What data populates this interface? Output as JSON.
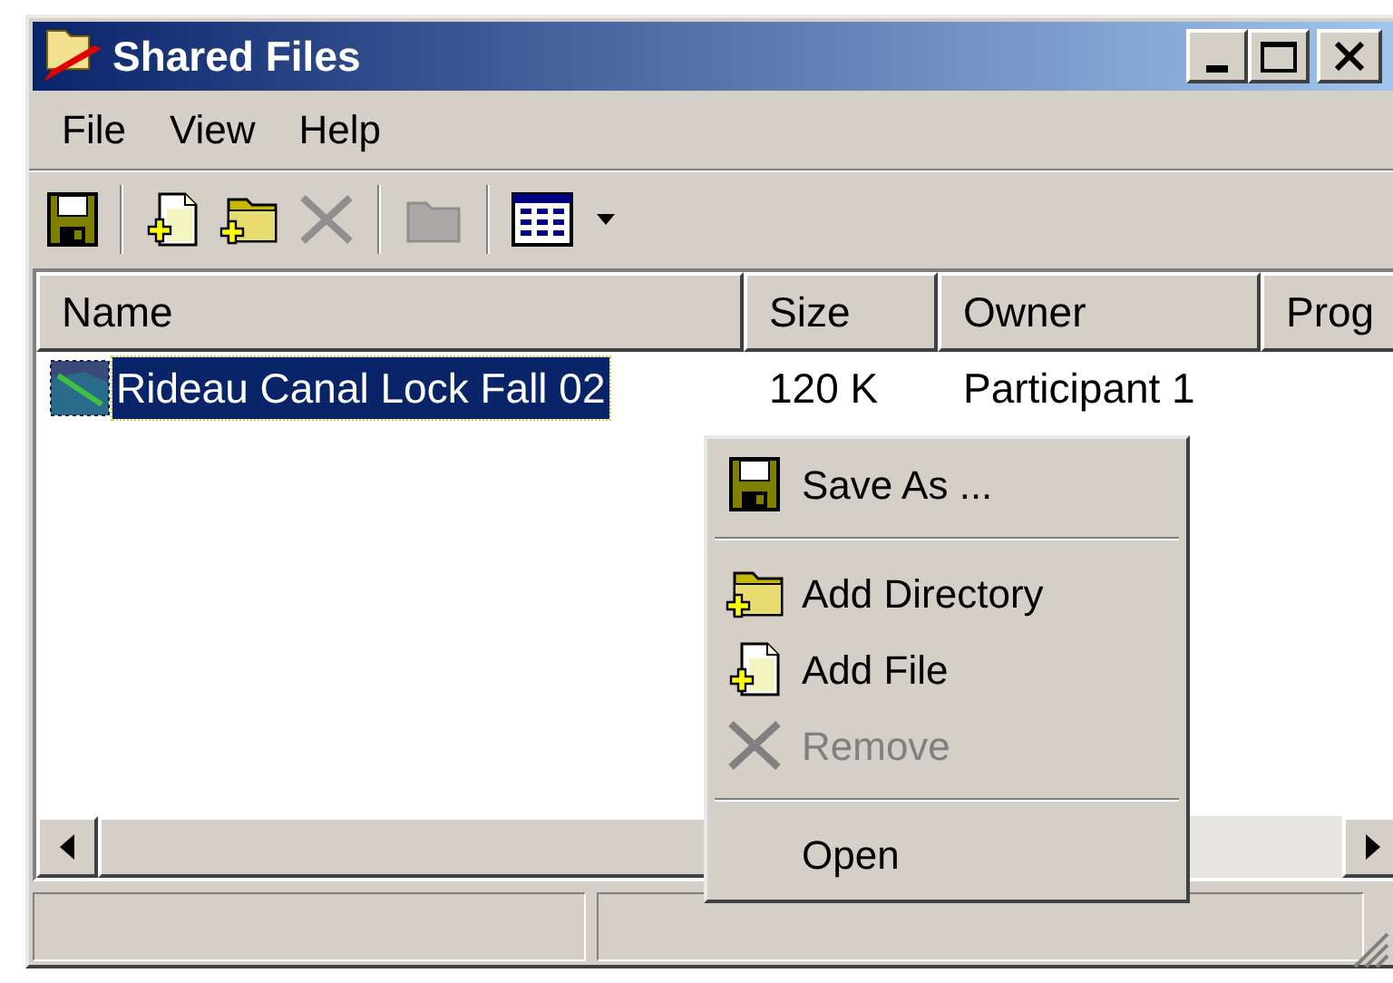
{
  "window": {
    "title": "Shared Files"
  },
  "menu_bar": [
    "File",
    "View",
    "Help"
  ],
  "toolbar": [
    {
      "kind": "save",
      "disabled": false
    },
    {
      "kind": "separator"
    },
    {
      "kind": "addfile",
      "disabled": false
    },
    {
      "kind": "adddir",
      "disabled": false
    },
    {
      "kind": "remove",
      "disabled": true
    },
    {
      "kind": "separator"
    },
    {
      "kind": "folder",
      "disabled": true
    },
    {
      "kind": "separator"
    },
    {
      "kind": "views",
      "disabled": false
    }
  ],
  "list": {
    "columns": [
      "Name",
      "Size",
      "Owner",
      "Prog"
    ],
    "rows": [
      {
        "cells": [
          "Rideau Canal Lock Fall 02",
          "120 K",
          "Participant 1"
        ],
        "selected": true
      }
    ]
  },
  "context_menu": [
    {
      "kind": "save",
      "label": "Save As ...",
      "disabled": false
    },
    {
      "kind": "separator"
    },
    {
      "kind": "adddir",
      "label": "Add Directory",
      "disabled": false
    },
    {
      "kind": "addfile",
      "label": "Add File",
      "disabled": false
    },
    {
      "kind": "remove",
      "label": "Remove",
      "disabled": true
    },
    {
      "kind": "separator"
    },
    {
      "kind": "plain",
      "label": "Open",
      "disabled": false
    }
  ]
}
